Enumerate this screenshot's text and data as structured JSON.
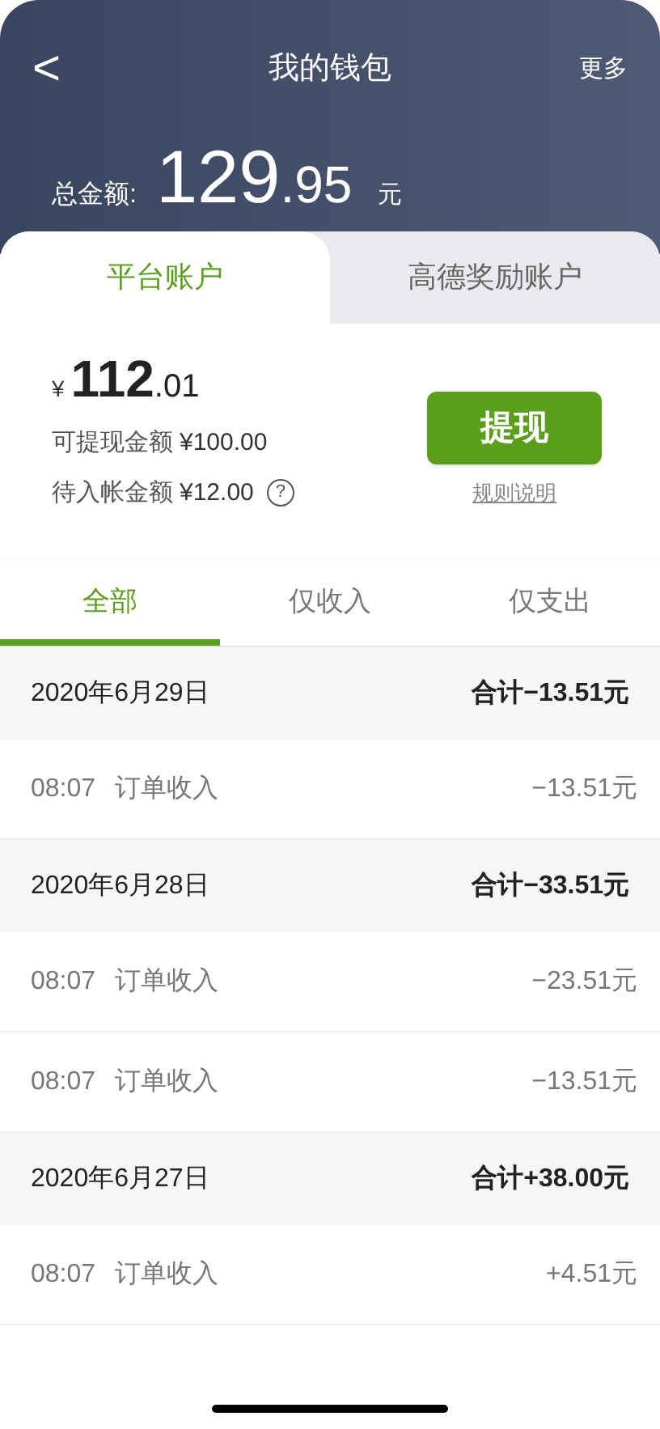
{
  "nav": {
    "back": "<",
    "title": "我的钱包",
    "more": "更多"
  },
  "total": {
    "label": "总金额:",
    "integer": "129",
    "decimal": ".95",
    "unit": "元"
  },
  "account_tabs": [
    {
      "label": "平台账户",
      "selected": true
    },
    {
      "label": "高德奖励账户",
      "selected": false
    }
  ],
  "balance": {
    "currency": "¥",
    "integer": "112",
    "decimal": ".01",
    "withdrawable_label": "可提现金额",
    "withdrawable": "¥100.00",
    "pending_label": "待入帐金额",
    "pending": "¥12.00",
    "help": "?"
  },
  "withdraw_button": "提现",
  "rules_link": "规则说明",
  "filter_tabs": [
    {
      "label": "全部",
      "selected": true
    },
    {
      "label": "仅收入",
      "selected": false
    },
    {
      "label": "仅支出",
      "selected": false
    }
  ],
  "days": [
    {
      "date": "2020年6月29日",
      "total": "合计−13.51元",
      "items": [
        {
          "time": "08:07",
          "title": "订单收入",
          "amount": "−13.51元"
        }
      ]
    },
    {
      "date": "2020年6月28日",
      "total": "合计−33.51元",
      "items": [
        {
          "time": "08:07",
          "title": "订单收入",
          "amount": "−23.51元"
        },
        {
          "time": "08:07",
          "title": "订单收入",
          "amount": "−13.51元"
        }
      ]
    },
    {
      "date": "2020年6月27日",
      "total": "合计+38.00元",
      "items": [
        {
          "time": "08:07",
          "title": "订单收入",
          "amount": "+4.51元"
        }
      ]
    }
  ]
}
